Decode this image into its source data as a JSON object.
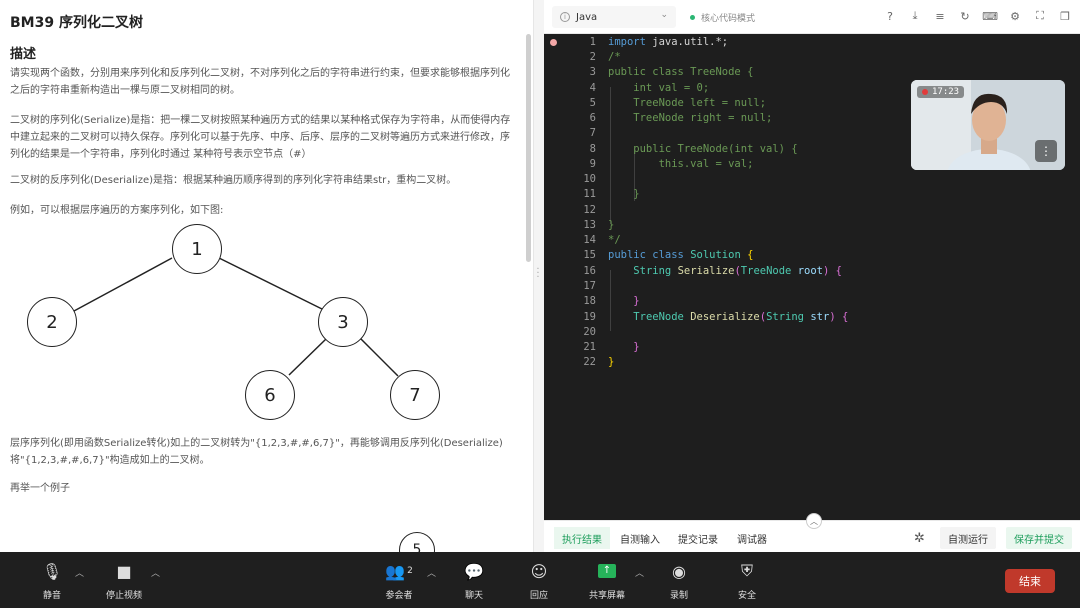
{
  "problem": {
    "title": "BM39  序列化二叉树",
    "section": "描述",
    "p1": "请实现两个函数，分别用来序列化和反序列化二叉树，不对序列化之后的字符串进行约束，但要求能够根据序列化之后的字符串重新构造出一棵与原二叉树相同的树。",
    "p2": "二叉树的序列化(Serialize)是指：把一棵二叉树按照某种遍历方式的结果以某种格式保存为字符串，从而使得内存中建立起来的二叉树可以持久保存。序列化可以基于先序、中序、后序、层序的二叉树等遍历方式来进行修改，序列化的结果是一个字符串，序列化时通过 某种符号表示空节点（#）",
    "p3": "二叉树的反序列化(Deserialize)是指：根据某种遍历顺序得到的序列化字符串结果str，重构二叉树。",
    "p4": "例如，可以根据层序遍历的方案序列化，如下图:",
    "tree": {
      "n1": "1",
      "n2": "2",
      "n3": "3",
      "n6": "6",
      "n7": "7"
    },
    "p5": "层序序列化(即用函数Serialize转化)如上的二叉树转为\"{1,2,3,#,#,6,7}\"，再能够调用反序列化(Deserialize)将\"{1,2,3,#,#,6,7}\"构造成如上的二叉树。",
    "p6": "再举一个例子",
    "partial_node": "5"
  },
  "editor": {
    "language": "Java",
    "mode": "核心代码模式",
    "line_numbers": [
      "1",
      "2",
      "3",
      "4",
      "5",
      "6",
      "7",
      "8",
      "9",
      "10",
      "11",
      "12",
      "13",
      "14",
      "15",
      "16",
      "17",
      "18",
      "19",
      "20",
      "21",
      "22"
    ],
    "tabs": [
      "执行结果",
      "自测输入",
      "提交记录",
      "调试器"
    ],
    "self_test": "自测运行",
    "save_submit": "保存并提交"
  },
  "video": {
    "timer": "17:23"
  },
  "meeting": {
    "mute": "静音",
    "stop_video": "停止视频",
    "participants": "参会者",
    "participants_count": "2",
    "chat": "聊天",
    "reactions": "回应",
    "share": "共享屏幕",
    "record": "录制",
    "security": "安全",
    "end": "结束"
  },
  "colors": {
    "accent_green": "#1e9e5c",
    "end_red": "#c0392b",
    "editor_bg": "#1e1e1e"
  }
}
